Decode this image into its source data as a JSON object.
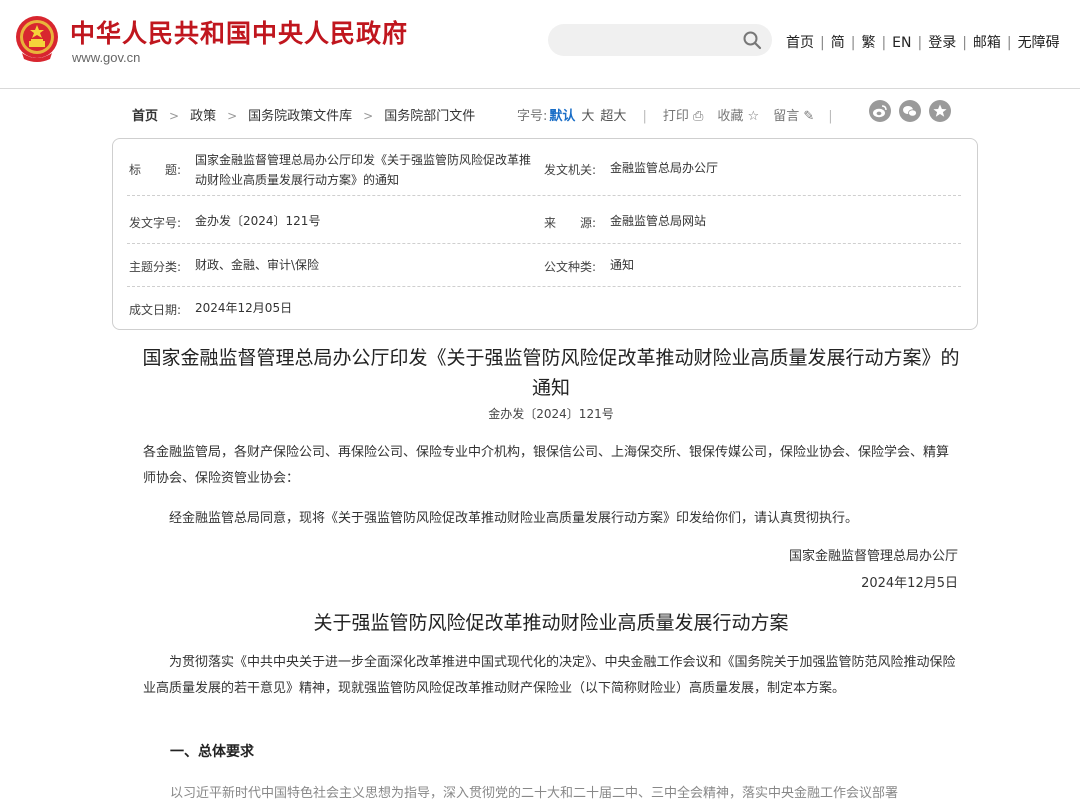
{
  "header": {
    "site_title": "中华人民共和国中央人民政府",
    "domain": "www.gov.cn",
    "search_placeholder": "",
    "nav": [
      "首页",
      "简",
      "繁",
      "EN",
      "登录",
      "邮箱",
      "无障碍"
    ]
  },
  "breadcrumb": {
    "items": [
      "首页",
      "政策",
      "国务院政策文件库",
      "国务院部门文件"
    ]
  },
  "tools": {
    "font_label": "字号:",
    "font_default": "默认",
    "font_large": "大",
    "font_xlarge": "超大",
    "print": "打印",
    "favorite": "收藏",
    "comment": "留言"
  },
  "info": {
    "title_label": "标　　题:",
    "title_value": "国家金融监督管理总局办公厅印发《关于强监管防风险促改革推动财险业高质量发展行动方案》的通知",
    "issuer_label": "发文机关:",
    "issuer_value": "金融监管总局办公厅",
    "docno_label": "发文字号:",
    "docno_value": "金办发〔2024〕121号",
    "source_label": "来　　源:",
    "source_value": "金融监管总局网站",
    "topic_label": "主题分类:",
    "topic_value": "财政、金融、审计\\保险",
    "type_label": "公文种类:",
    "type_value": "通知",
    "date_label": "成文日期:",
    "date_value": "2024年12月05日"
  },
  "doc": {
    "title": "国家金融监督管理总局办公厅印发《关于强监管防风险促改革推动财险业高质量发展行动方案》的通知",
    "doc_number": "金办发〔2024〕121号",
    "recipients": "各金融监管局，各财产保险公司、再保险公司、保险专业中介机构，银保信公司、上海保交所、银保传媒公司，保险业协会、保险学会、精算师协会、保险资管业协会：",
    "body": "经金融监管总局同意，现将《关于强监管防风险促改革推动财险业高质量发展行动方案》印发给你们，请认真贯彻执行。",
    "signature": "国家金融监督管理总局办公厅",
    "sign_date": "2024年12月5日",
    "plan_title": "关于强监管防风险促改革推动财险业高质量发展行动方案",
    "plan_intro": "为贯彻落实《中共中央关于进一步全面深化改革推进中国式现代化的决定》、中央金融工作会议和《国务院关于加强监管防范风险推动保险业高质量发展的若干意见》精神，现就强监管防风险促改革推动财产保险业（以下简称财险业）高质量发展，制定本方案。",
    "section1": "一、总体要求",
    "cutoff_text": "以习近平新时代中国特色社会主义思想为指导，深入贯彻党的二十大和二十届二中、三中全会精神，落实中央金融工作会议部署"
  },
  "colors": {
    "brand_red": "#c0161e",
    "link_blue": "#1a6ec7"
  }
}
